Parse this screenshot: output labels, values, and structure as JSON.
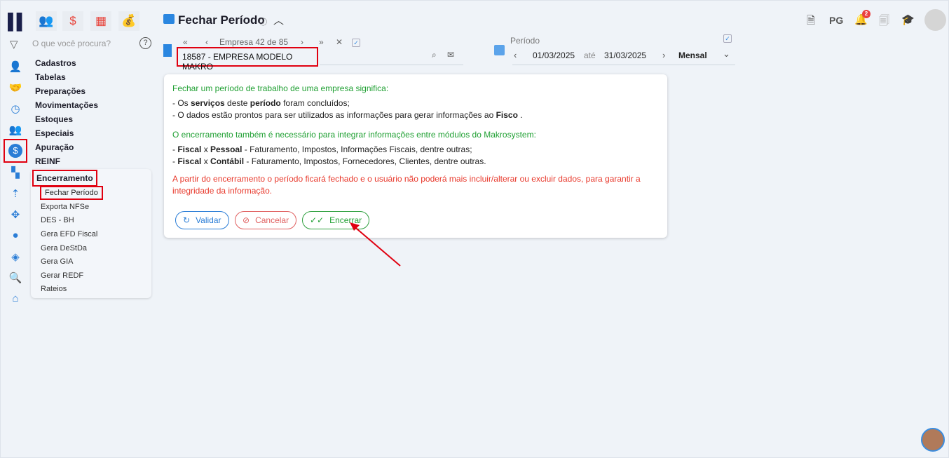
{
  "header": {
    "title": "Fechar Período",
    "company_nav": "Empresa 42 de 85",
    "company": "18587 - EMPRESA MODELO MAKRO",
    "period_label": "Período",
    "date_from": "01/03/2025",
    "date_sep": "até",
    "date_to": "31/03/2025",
    "frequency": "Mensal",
    "pg": "PG",
    "notifications": "2"
  },
  "search": {
    "placeholder": "O que você procura?"
  },
  "menu": [
    "Cadastros",
    "Tabelas",
    "Preparações",
    "Movimentações",
    "Estoques",
    "Especiais",
    "Apuração",
    "REINF"
  ],
  "submenu": {
    "title": "Encerramento",
    "items": [
      "Fechar Período",
      "Exporta NFSe",
      "DES - BH",
      "Gera EFD Fiscal",
      "Gera DeStDa",
      "Gera GIA",
      "Gerar REDF",
      "Rateios"
    ]
  },
  "card": {
    "intro": "Fechar um período de trabalho de uma empresa significa:",
    "l1a": "- Os ",
    "l1b": "serviços",
    "l1c": " deste ",
    "l1d": "período",
    "l1e": " foram concluídos;",
    "l2a": "- O dados estão prontos para ser utilizados as informações para gerar informações ao ",
    "l2b": "Fisco",
    "l2c": " .",
    "intro2": "O encerramento também é necessário para integrar informações entre módulos do Makrosystem:",
    "l3a": "- ",
    "l3b": "Fiscal",
    "l3c": " x ",
    "l3d": "Pessoal",
    "l3e": " - Faturamento, Impostos, Informações Fiscais, dentre outras;",
    "l4a": "- ",
    "l4b": "Fiscal",
    "l4c": " x ",
    "l4d": "Contábil",
    "l4e": " - Faturamento, Impostos, Fornecedores, Clientes, dentre outras.",
    "warning": "A partir do encerramento o período ficará fechado e o usuário não poderá mais incluir/alterar ou excluir dados, para garantir a integridade da informação.",
    "validar": "Validar",
    "cancelar": "Cancelar",
    "encerrar": "Encerrar"
  }
}
